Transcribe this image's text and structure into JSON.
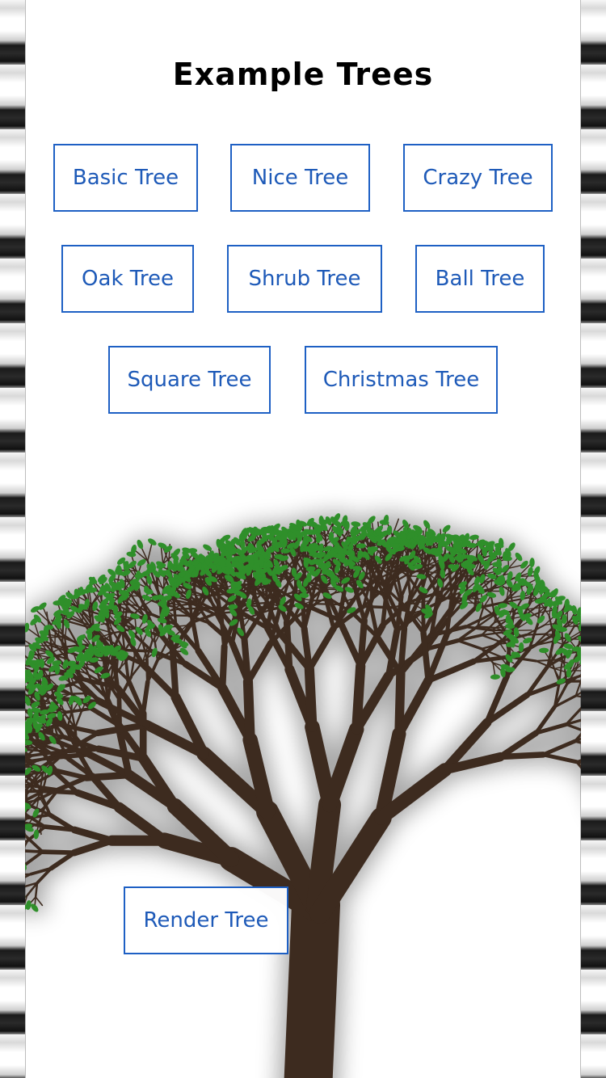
{
  "page": {
    "title": "Example Trees"
  },
  "buttons": {
    "basic": "Basic Tree",
    "nice": "Nice Tree",
    "crazy": "Crazy Tree",
    "oak": "Oak Tree",
    "shrub": "Shrub Tree",
    "ball": "Ball Tree",
    "square": "Square Tree",
    "christmas": "Christmas Tree",
    "render": "Render Tree"
  },
  "colors": {
    "button_border": "#1e60c4",
    "button_text": "#1e5ab8",
    "trunk": "#3d2b1f",
    "leaf": "#2f8f2a"
  }
}
